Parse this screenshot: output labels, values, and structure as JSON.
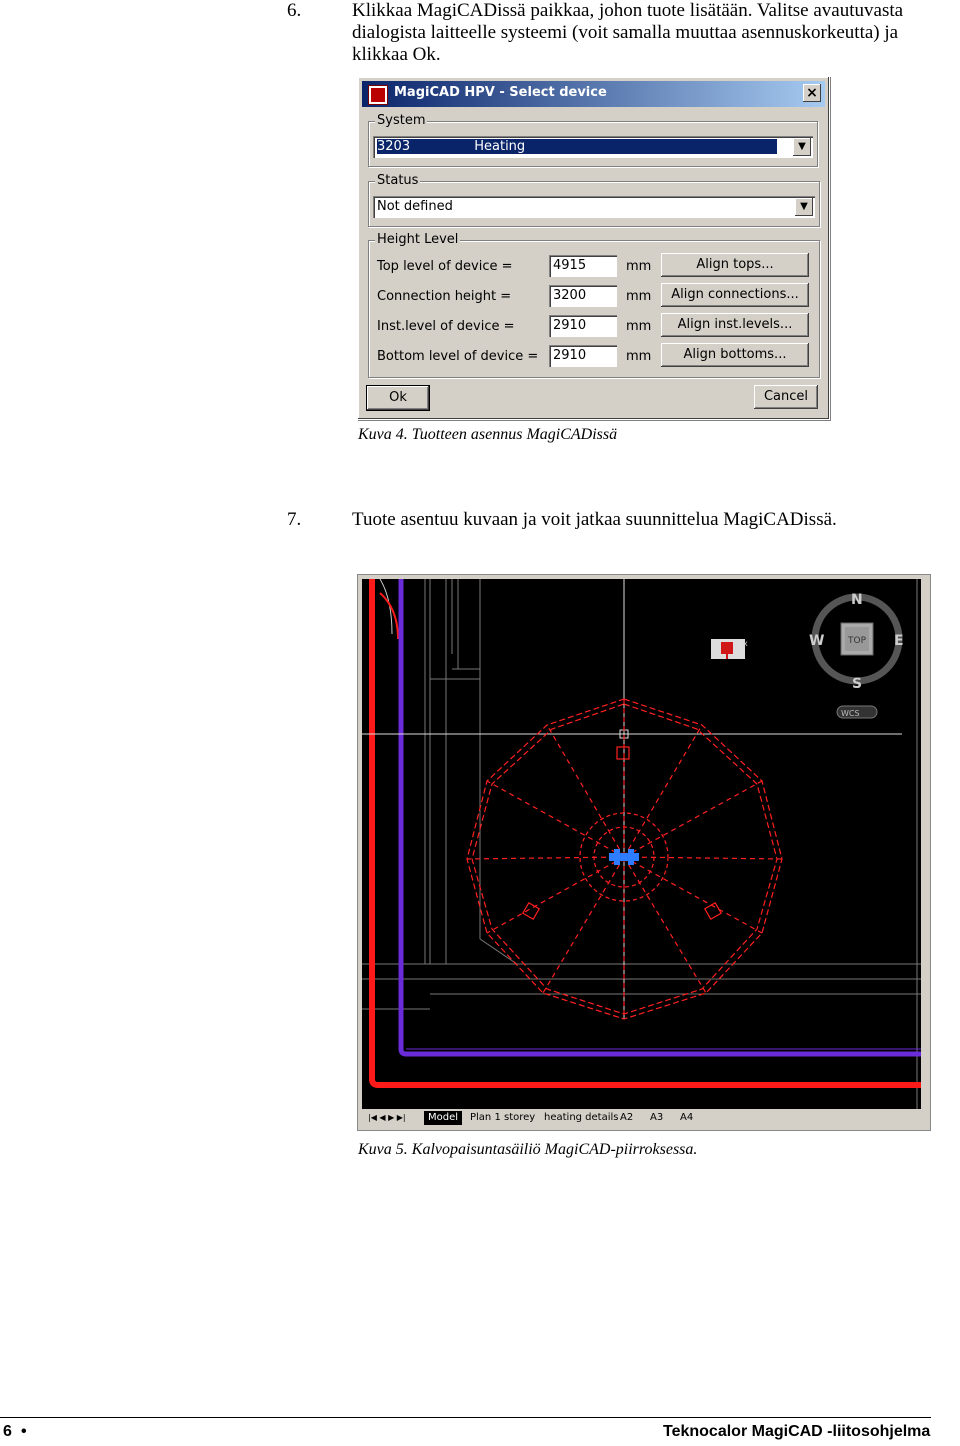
{
  "step6": {
    "number": "6.",
    "text": "Klikkaa MagiCADissä paikkaa, johon tuote lisätään. Valitse avautuvasta dialogista laitteelle systeemi (voit samalla muuttaa asennuskorkeutta) ja klikkaa Ok."
  },
  "dialog": {
    "title": "MagiCAD HPV - Select device",
    "close": "×",
    "system_group": "System",
    "system_code": "3203",
    "system_name": "Heating",
    "status_group": "Status",
    "status_value": "Not defined",
    "height_group": "Height Level",
    "rows": [
      {
        "label": "Top level of device =",
        "value": "4915",
        "unit": "mm",
        "button": "Align tops..."
      },
      {
        "label": "Connection height =",
        "value": "3200",
        "unit": "mm",
        "button": "Align connections..."
      },
      {
        "label": "Inst.level of device =",
        "value": "2910",
        "unit": "mm",
        "button": "Align inst.levels..."
      },
      {
        "label": "Bottom level of device =",
        "value": "2910",
        "unit": "mm",
        "button": "Align bottoms..."
      }
    ],
    "ok": "Ok",
    "cancel": "Cancel",
    "dropdown_arrow": "▼"
  },
  "caption4": "Kuva 4. Tuotteen asennus MagiCADissä",
  "step7": {
    "number": "7.",
    "text": "Tuote asentuu kuvaan ja voit jatkaa suunnittelua MagiCADissä."
  },
  "cad": {
    "compass": {
      "n": "N",
      "s": "S",
      "e": "E",
      "w": "W",
      "top": "TOP",
      "wcs": "WCS"
    },
    "tabs": [
      "Model",
      "Plan 1 storey",
      "heating details",
      "A2",
      "A3",
      "A4"
    ],
    "colors": {
      "red": "#ff1a1a",
      "purple": "#6a2cd8",
      "blue": "#2e7cff",
      "grey": "#777777"
    }
  },
  "caption5": "Kuva 5. Kalvopaisuntasäiliö MagiCAD-piirroksessa.",
  "footer": {
    "page": "6",
    "bullet": "•",
    "title": "Teknocalor MagiCAD -liitosohjelma"
  }
}
